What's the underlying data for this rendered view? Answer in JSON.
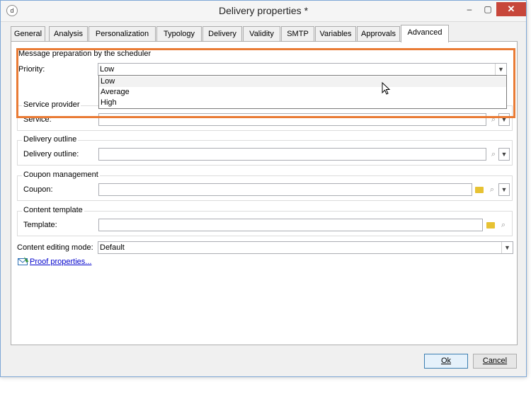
{
  "window": {
    "title": "Delivery properties *",
    "app_icon": "d",
    "min_glyph": "–",
    "max_glyph": "▢",
    "close_glyph": "✕"
  },
  "tabs": [
    {
      "label": "General"
    },
    {
      "label": "Analysis"
    },
    {
      "label": "Personalization"
    },
    {
      "label": "Typology"
    },
    {
      "label": "Delivery"
    },
    {
      "label": "Validity"
    },
    {
      "label": "SMTP"
    },
    {
      "label": "Variables"
    },
    {
      "label": "Approvals"
    },
    {
      "label": "Advanced",
      "active": true
    }
  ],
  "scheduler": {
    "title": "Message preparation by the scheduler",
    "priority_label": "Priority:",
    "priority_value": "Low",
    "options": [
      "Low",
      "Average",
      "High"
    ]
  },
  "service_provider": {
    "title": "Service provider",
    "service_label": "Service:",
    "service_value": ""
  },
  "delivery_outline": {
    "title": "Delivery outline",
    "label": "Delivery outline:",
    "value": ""
  },
  "coupon": {
    "title": "Coupon management",
    "label": "Coupon:",
    "value": ""
  },
  "content_template": {
    "title": "Content template",
    "label": "Template:",
    "value": ""
  },
  "editing_mode": {
    "label": "Content editing mode:",
    "value": "Default"
  },
  "proof": {
    "link": "Proof properties..."
  },
  "buttons": {
    "ok": "Ok",
    "cancel": "Cancel"
  },
  "colors": {
    "highlight": "#e97b35",
    "close": "#c7463a",
    "link": "#0000cc"
  },
  "icons": {
    "dropdown": "chevron-down-icon",
    "search": "magnifier-icon",
    "folder": "folder-icon",
    "proof": "proof-envelope-icon"
  }
}
